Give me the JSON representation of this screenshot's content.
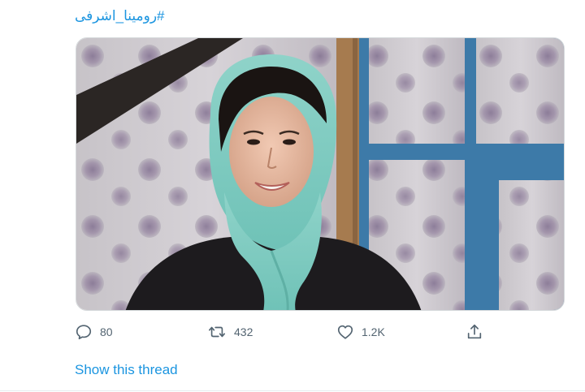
{
  "tweet": {
    "hashtag": "#رومینا_اشرفی",
    "media": {
      "subject": "photo-girl-teal-headscarf"
    },
    "actions": {
      "reply_count": "80",
      "retweet_count": "432",
      "like_count": "1.2K",
      "share_icon": "share-icon"
    },
    "show_thread": "Show this thread"
  },
  "colors": {
    "link": "#1b95e0",
    "action_gray": "#536471"
  }
}
